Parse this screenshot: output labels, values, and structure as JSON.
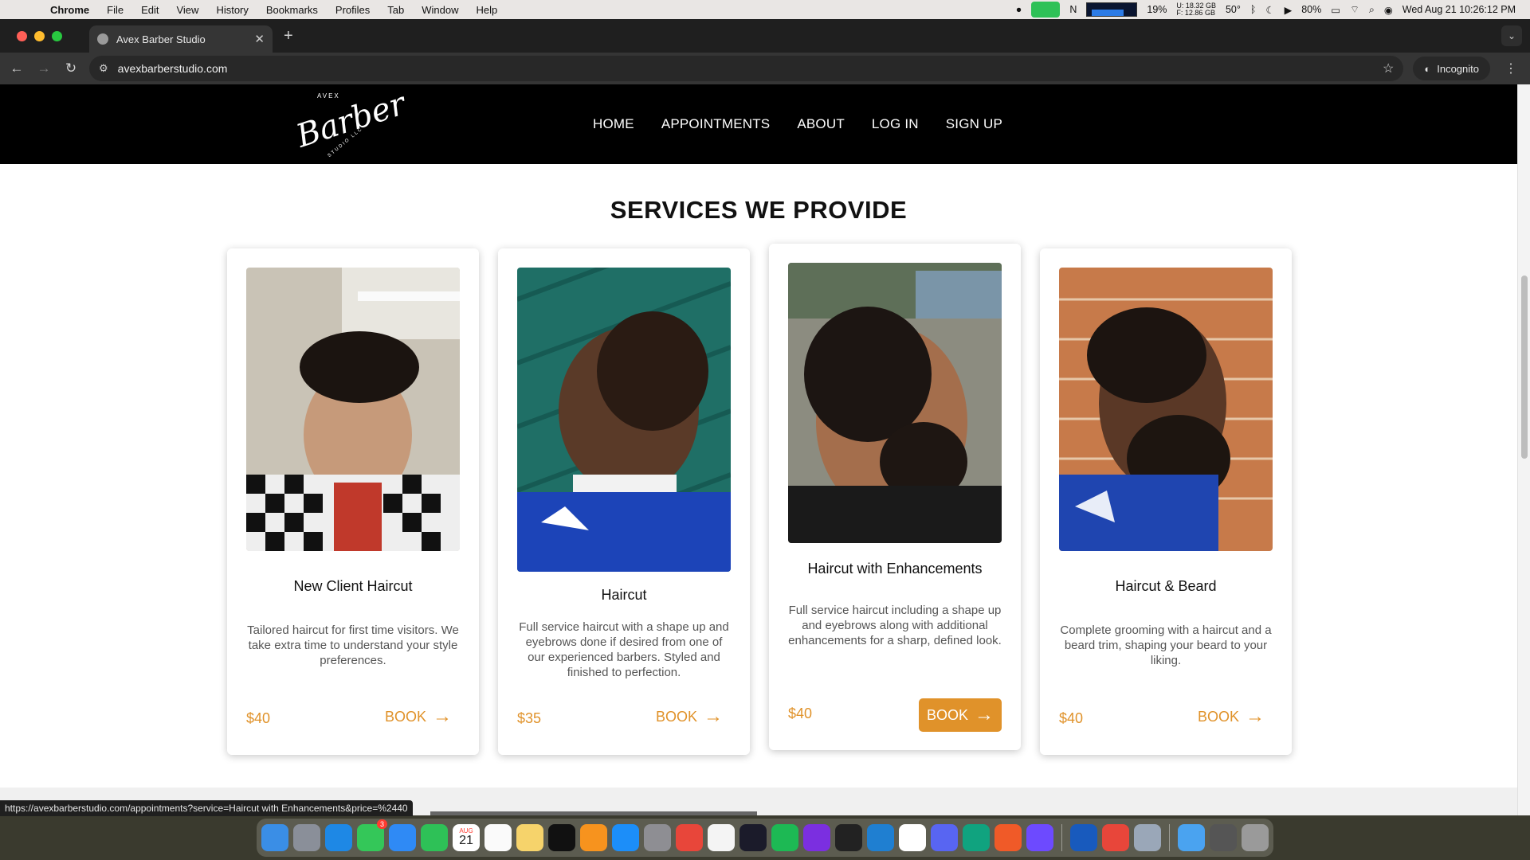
{
  "menubar": {
    "app": "Chrome",
    "items": [
      "File",
      "Edit",
      "View",
      "History",
      "Bookmarks",
      "Profiles",
      "Tab",
      "Window",
      "Help"
    ],
    "cpu": "19%",
    "mem_used": "U: 18.32 GB",
    "mem_free": "F: 12.86 GB",
    "temp": "50°",
    "battery": "80%",
    "datetime": "Wed Aug 21  10:26:12 PM"
  },
  "browser": {
    "tab_title": "Avex Barber Studio",
    "url": "avexbarberstudio.com",
    "incognito_label": "Incognito",
    "status_url": "https://avexbarberstudio.com/appointments?service=Haircut with Enhancements&price=%2440"
  },
  "site": {
    "logo": {
      "top": "AVEX",
      "script": "Barber",
      "bottom": "STUDIO LLC"
    },
    "nav": [
      "HOME",
      "APPOINTMENTS",
      "ABOUT",
      "LOG IN",
      "SIGN UP"
    ],
    "section_title": "SERVICES WE PROVIDE",
    "services": [
      {
        "name": "New Client Haircut",
        "description": "Tailored haircut for first time visitors. We take extra time to understand your style preferences.",
        "price": "$40",
        "book_label": "BOOK"
      },
      {
        "name": "Haircut",
        "description": "Full service haircut with a shape up and eyebrows done if desired from one of our experienced barbers. Styled and finished to perfection.",
        "price": "$35",
        "book_label": "BOOK"
      },
      {
        "name": "Haircut with Enhancements",
        "description": "Full service haircut including a shape up and eyebrows along with additional enhancements for a sharp, defined look.",
        "price": "$40",
        "book_label": "BOOK"
      },
      {
        "name": "Haircut & Beard",
        "description": "Complete grooming with a haircut and a beard trim, shaping your beard to your liking.",
        "price": "$40",
        "book_label": "BOOK"
      }
    ]
  },
  "dock": {
    "calendar_month": "AUG",
    "calendar_day": "21",
    "messages_badge": "3",
    "icons": [
      "finder-icon",
      "launchpad-icon",
      "safari-icon",
      "messages-icon",
      "mail-icon",
      "facetime-icon",
      "calendar-icon",
      "reminders-icon",
      "notes-icon",
      "tv-icon",
      "pages-icon",
      "app-store-icon",
      "settings-icon",
      "chrome-icon",
      "activity-monitor-icon",
      "speedtest-icon",
      "spotify-icon",
      "intellij-icon",
      "terminal-icon",
      "vscode-icon",
      "notion-icon",
      "discord-icon",
      "chatgpt-icon",
      "paw-icon",
      "proton-icon",
      "word-icon",
      "chrome-2-icon",
      "preview-icon",
      "downloads-icon",
      "grid-icon",
      "trash-icon"
    ]
  }
}
